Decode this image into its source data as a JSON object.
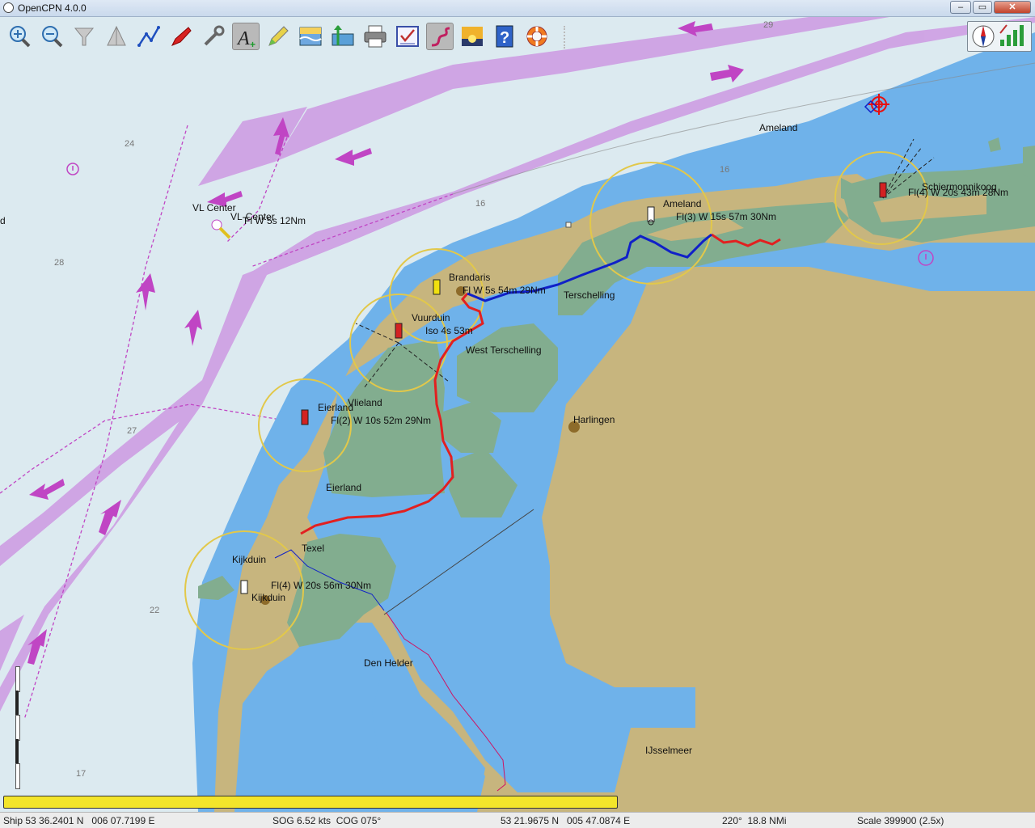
{
  "window": {
    "title": "OpenCPN 4.0.0",
    "minimize": "–",
    "maximize": "▭",
    "close": "✕"
  },
  "toolbar": {
    "buttons": [
      {
        "name": "zoom-in-button",
        "icon": "zoom-in-icon"
      },
      {
        "name": "zoom-out-button",
        "icon": "zoom-out-icon"
      },
      {
        "name": "scale-in-button",
        "icon": "funnel-icon"
      },
      {
        "name": "scale-out-button",
        "icon": "triangle-icon"
      },
      {
        "name": "route-button",
        "icon": "route-icon"
      },
      {
        "name": "track-button",
        "icon": "boat-icon"
      },
      {
        "name": "settings-button",
        "icon": "wrench-icon"
      },
      {
        "name": "text-toggle-button",
        "icon": "text-a-icon",
        "active": true
      },
      {
        "name": "current-button",
        "icon": "pencil-icon"
      },
      {
        "name": "tide-button",
        "icon": "tide-icon"
      },
      {
        "name": "current-level-button",
        "icon": "current-icon"
      },
      {
        "name": "print-button",
        "icon": "printer-icon"
      },
      {
        "name": "route-manager-button",
        "icon": "checklist-icon"
      },
      {
        "name": "track-toggle-button",
        "icon": "track-icon",
        "active": true
      },
      {
        "name": "color-scheme-button",
        "icon": "sunset-icon"
      },
      {
        "name": "help-button",
        "icon": "help-icon"
      },
      {
        "name": "mob-button",
        "icon": "lifebuoy-icon"
      }
    ]
  },
  "map": {
    "depth_labels": [
      {
        "text": "29"
      },
      {
        "text": "24"
      },
      {
        "text": "16"
      },
      {
        "text": "16"
      },
      {
        "text": "28"
      },
      {
        "text": "27"
      },
      {
        "text": "22"
      },
      {
        "text": "17"
      }
    ],
    "place_labels": [
      "Ameland",
      "VL Center",
      "VL-Center",
      "Fl W 5s 12Nm",
      "Ameland",
      "Fl(3) W 15s 57m 30Nm",
      "Schiermonnikoog",
      "Fl(4) W 20s 43m 28Nm",
      "Brandaris",
      "Fl W 5s 54m 29Nm",
      "Terschelling",
      "Vuurduin",
      "Iso 4s 53m",
      "West Terschelling",
      "Vlieland",
      "Eierland",
      "Fl(2) W 10s 52m 29Nm",
      "Harlingen",
      "Eierland",
      "Texel",
      "Kijkduin",
      "Fl(4) W 20s 56m 30Nm",
      "Kijkduin",
      "Den Helder",
      "IJsselmeer",
      "d"
    ]
  },
  "progress": {
    "fill": 1.0
  },
  "status": {
    "ship": "Ship 53 36.2401 N   006 07.7199 E",
    "sog": "SOG 6.52 kts  COG 075°",
    "cursor": "53 21.9675 N   005 47.0874 E",
    "bearing": "220°  18.8 NMi",
    "scale": "Scale 399900 (2.5x)"
  },
  "colors": {
    "deep_water": "#dceaf0",
    "shallow_water": "#6fb2ea",
    "land": "#c7b57e",
    "drying": "#82ad8f",
    "tss": "#cfa2e4",
    "arrow": "#c045c4",
    "route_red": "#e22020",
    "route_blue": "#1020c8",
    "light_ring": "#e2c84a"
  }
}
